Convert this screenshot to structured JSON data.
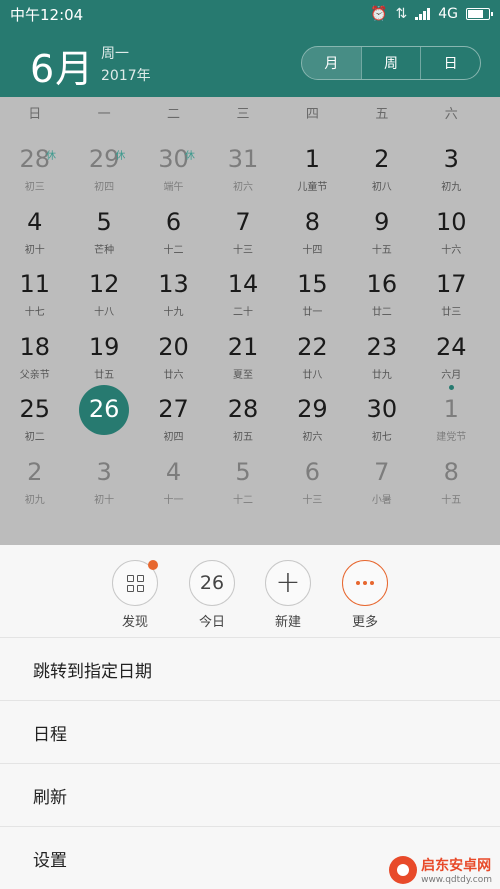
{
  "status": {
    "time": "中午12:04",
    "network": "4G"
  },
  "header": {
    "month": "6月",
    "weekday": "周一",
    "year": "2017年",
    "views": [
      "月",
      "周",
      "日"
    ]
  },
  "weekdays": [
    "日",
    "一",
    "二",
    "三",
    "四",
    "五",
    "六"
  ],
  "calendar": [
    [
      {
        "n": "28",
        "l": "初三",
        "other": true,
        "tag": "休"
      },
      {
        "n": "29",
        "l": "初四",
        "other": true,
        "tag": "休"
      },
      {
        "n": "30",
        "l": "端午",
        "other": true,
        "tag": "休"
      },
      {
        "n": "31",
        "l": "初六",
        "other": true
      },
      {
        "n": "1",
        "l": "儿童节"
      },
      {
        "n": "2",
        "l": "初八"
      },
      {
        "n": "3",
        "l": "初九"
      }
    ],
    [
      {
        "n": "4",
        "l": "初十"
      },
      {
        "n": "5",
        "l": "芒种"
      },
      {
        "n": "6",
        "l": "十二"
      },
      {
        "n": "7",
        "l": "十三"
      },
      {
        "n": "8",
        "l": "十四"
      },
      {
        "n": "9",
        "l": "十五"
      },
      {
        "n": "10",
        "l": "十六"
      }
    ],
    [
      {
        "n": "11",
        "l": "十七"
      },
      {
        "n": "12",
        "l": "十八"
      },
      {
        "n": "13",
        "l": "十九"
      },
      {
        "n": "14",
        "l": "二十"
      },
      {
        "n": "15",
        "l": "廿一"
      },
      {
        "n": "16",
        "l": "廿二"
      },
      {
        "n": "17",
        "l": "廿三"
      }
    ],
    [
      {
        "n": "18",
        "l": "父亲节"
      },
      {
        "n": "19",
        "l": "廿五"
      },
      {
        "n": "20",
        "l": "廿六"
      },
      {
        "n": "21",
        "l": "夏至"
      },
      {
        "n": "22",
        "l": "廿八"
      },
      {
        "n": "23",
        "l": "廿九"
      },
      {
        "n": "24",
        "l": "六月"
      }
    ],
    [
      {
        "n": "25",
        "l": "初二"
      },
      {
        "n": "26",
        "l": "",
        "today": true
      },
      {
        "n": "27",
        "l": "初四"
      },
      {
        "n": "28",
        "l": "初五"
      },
      {
        "n": "29",
        "l": "初六"
      },
      {
        "n": "30",
        "l": "初七"
      },
      {
        "n": "1",
        "l": "建党节",
        "other": true,
        "dot": true
      }
    ],
    [
      {
        "n": "2",
        "l": "初九",
        "other": true
      },
      {
        "n": "3",
        "l": "初十",
        "other": true
      },
      {
        "n": "4",
        "l": "十一",
        "other": true
      },
      {
        "n": "5",
        "l": "十二",
        "other": true
      },
      {
        "n": "6",
        "l": "十三",
        "other": true
      },
      {
        "n": "7",
        "l": "小暑",
        "other": true
      },
      {
        "n": "8",
        "l": "十五",
        "other": true
      }
    ]
  ],
  "actions": {
    "discover": "发现",
    "today": "今日",
    "today_num": "26",
    "new": "新建",
    "more": "更多"
  },
  "menu": [
    "跳转到指定日期",
    "日程",
    "刷新",
    "设置"
  ],
  "watermark": {
    "name": "启东安卓网",
    "url": "www.qdtdy.com"
  },
  "colors": {
    "accent": "#277a70",
    "orange": "#e7672f"
  }
}
